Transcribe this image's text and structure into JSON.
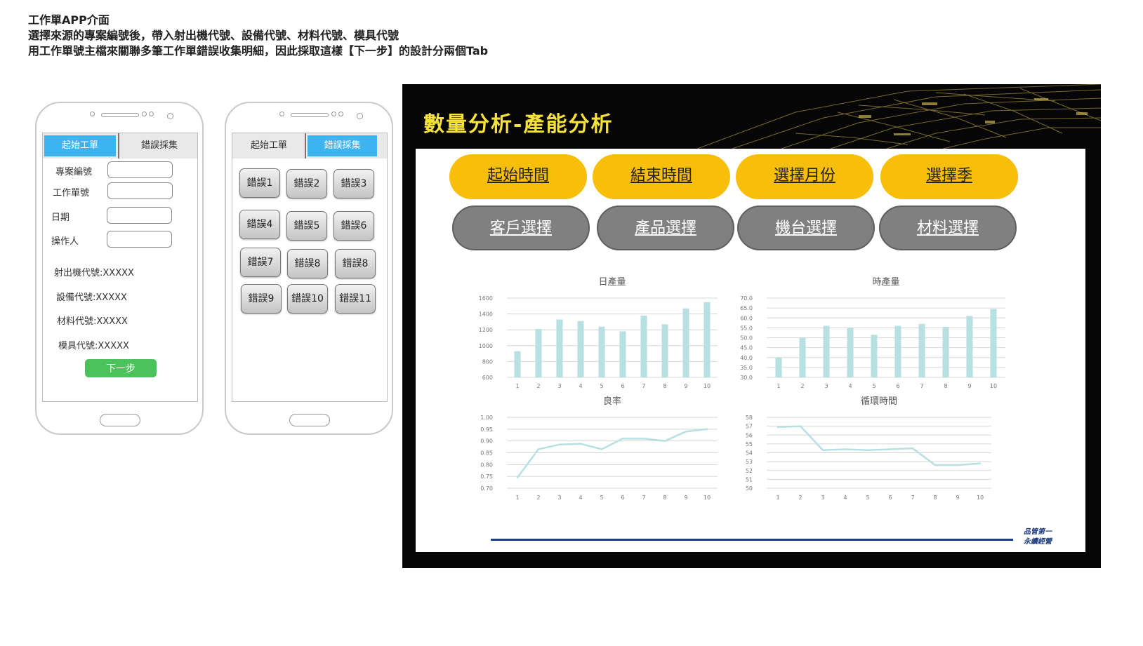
{
  "intro": {
    "line1": "工作單APP介面",
    "line2": "選擇來源的專案編號後，帶入射出機代號、設備代號、材料代號、模具代號",
    "line3": "用工作單號主檔來關聯多筆工作單錯誤收集明細，因此採取這樣【下一步】的設計分兩個Tab"
  },
  "phone1": {
    "tabs": {
      "start": "起始工單",
      "collect": "錯誤採集"
    },
    "active_tab": "start",
    "fields": [
      {
        "label": "專案編號",
        "value": ""
      },
      {
        "label": "工作單號",
        "value": ""
      },
      {
        "label": "日期",
        "value": ""
      },
      {
        "label": "操作人",
        "value": ""
      }
    ],
    "codes": [
      "射出機代號:XXXXX",
      "設備代號:XXXXX",
      "材料代號:XXXXX",
      "模具代號:XXXXX"
    ],
    "next_button": "下一步",
    "colors": {
      "tab_active": "#3db3f0",
      "next_button": "#4cc25c"
    }
  },
  "phone2": {
    "tabs": {
      "start": "起始工單",
      "collect": "錯誤採集"
    },
    "active_tab": "collect",
    "error_buttons": [
      "錯誤1",
      "錯誤2",
      "錯誤3",
      "錯誤4",
      "錯誤5",
      "錯誤6",
      "錯誤7",
      "錯誤8",
      "錯誤8",
      "錯誤9",
      "錯誤10",
      "錯誤11"
    ]
  },
  "slide": {
    "title": "數量分析-產能分析",
    "filters_primary": [
      "起始時間",
      "結束時間",
      "選擇月份",
      "選擇季"
    ],
    "filters_secondary": [
      "客戶選擇",
      "產品選擇",
      "機台選擇",
      "材料選擇"
    ],
    "colors": {
      "title": "#f7e23a",
      "pill_primary": "#f7be0b",
      "pill_secondary": "#808080",
      "bar": "#b8dfe2",
      "line": "#b8dfe2",
      "footer": "#1d3a82"
    },
    "footer_logo": [
      "品管第一",
      "永續經營"
    ]
  },
  "chart_data": [
    {
      "type": "bar",
      "title": "日產量",
      "categories": [
        "1",
        "2",
        "3",
        "4",
        "5",
        "6",
        "7",
        "8",
        "9",
        "10"
      ],
      "values": [
        930,
        1210,
        1330,
        1310,
        1240,
        1180,
        1380,
        1270,
        1470,
        1550
      ],
      "yticks": [
        "1600",
        "1400",
        "1200",
        "1000",
        "800",
        "600"
      ],
      "ylim": [
        600,
        1600
      ]
    },
    {
      "type": "bar",
      "title": "時產量",
      "categories": [
        "1",
        "2",
        "3",
        "4",
        "5",
        "6",
        "7",
        "8",
        "9",
        "10"
      ],
      "values": [
        40,
        50,
        56,
        55,
        51.5,
        56,
        57,
        55.5,
        61,
        64.5
      ],
      "yticks": [
        "70.0",
        "65.0",
        "60.0",
        "55.0",
        "50.0",
        "45.0",
        "40.0",
        "35.0",
        "30.0"
      ],
      "ylim": [
        30,
        70
      ]
    },
    {
      "type": "line",
      "title": "良率",
      "categories": [
        "1",
        "2",
        "3",
        "4",
        "5",
        "6",
        "7",
        "8",
        "9",
        "10"
      ],
      "values": [
        0.745,
        0.865,
        0.885,
        0.888,
        0.865,
        0.91,
        0.91,
        0.9,
        0.94,
        0.95
      ],
      "yticks": [
        "1.00",
        "0.95",
        "0.90",
        "0.85",
        "0.80",
        "0.75",
        "0.70"
      ],
      "ylim": [
        0.7,
        1.0
      ]
    },
    {
      "type": "line",
      "title": "循環時間",
      "categories": [
        "1",
        "2",
        "3",
        "4",
        "5",
        "6",
        "7",
        "8",
        "9",
        "10"
      ],
      "values": [
        56.9,
        57.0,
        54.3,
        54.4,
        54.3,
        54.4,
        54.5,
        52.6,
        52.6,
        52.8
      ],
      "yticks": [
        "58",
        "57",
        "56",
        "55",
        "54",
        "53",
        "52",
        "51",
        "50"
      ],
      "ylim": [
        50,
        58
      ]
    }
  ]
}
